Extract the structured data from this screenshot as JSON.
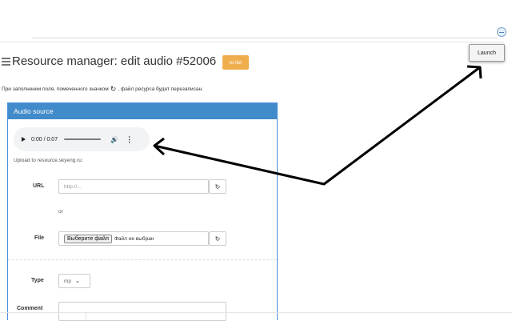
{
  "toolbar": {
    "launch_label": "Launch"
  },
  "header": {
    "title": "Resource manager: edit audio #52006",
    "to_list_label": "to list"
  },
  "notice": {
    "before_icon": "При заполнении поля, помеченного значком",
    "icon": "refresh-icon",
    "after_icon": ", файл ресурса будет перезаписан."
  },
  "panel": {
    "title": "Audio source",
    "player": {
      "time": "0:00 / 0:07"
    },
    "upload_label": "Upload to resource.skyeng.ru:",
    "url": {
      "label": "URL",
      "placeholder": "http://..."
    },
    "or_text": "or",
    "file": {
      "label": "File",
      "button_label": "Выберите файл",
      "status": "Файл не выбран"
    },
    "type": {
      "label": "Type",
      "selected": "mp"
    },
    "comment": {
      "label": "Comment",
      "value": ""
    }
  },
  "colors": {
    "panel_header": "#428bca",
    "to_list_button": "#f0ad4e",
    "annotation_arrow": "#000000"
  }
}
